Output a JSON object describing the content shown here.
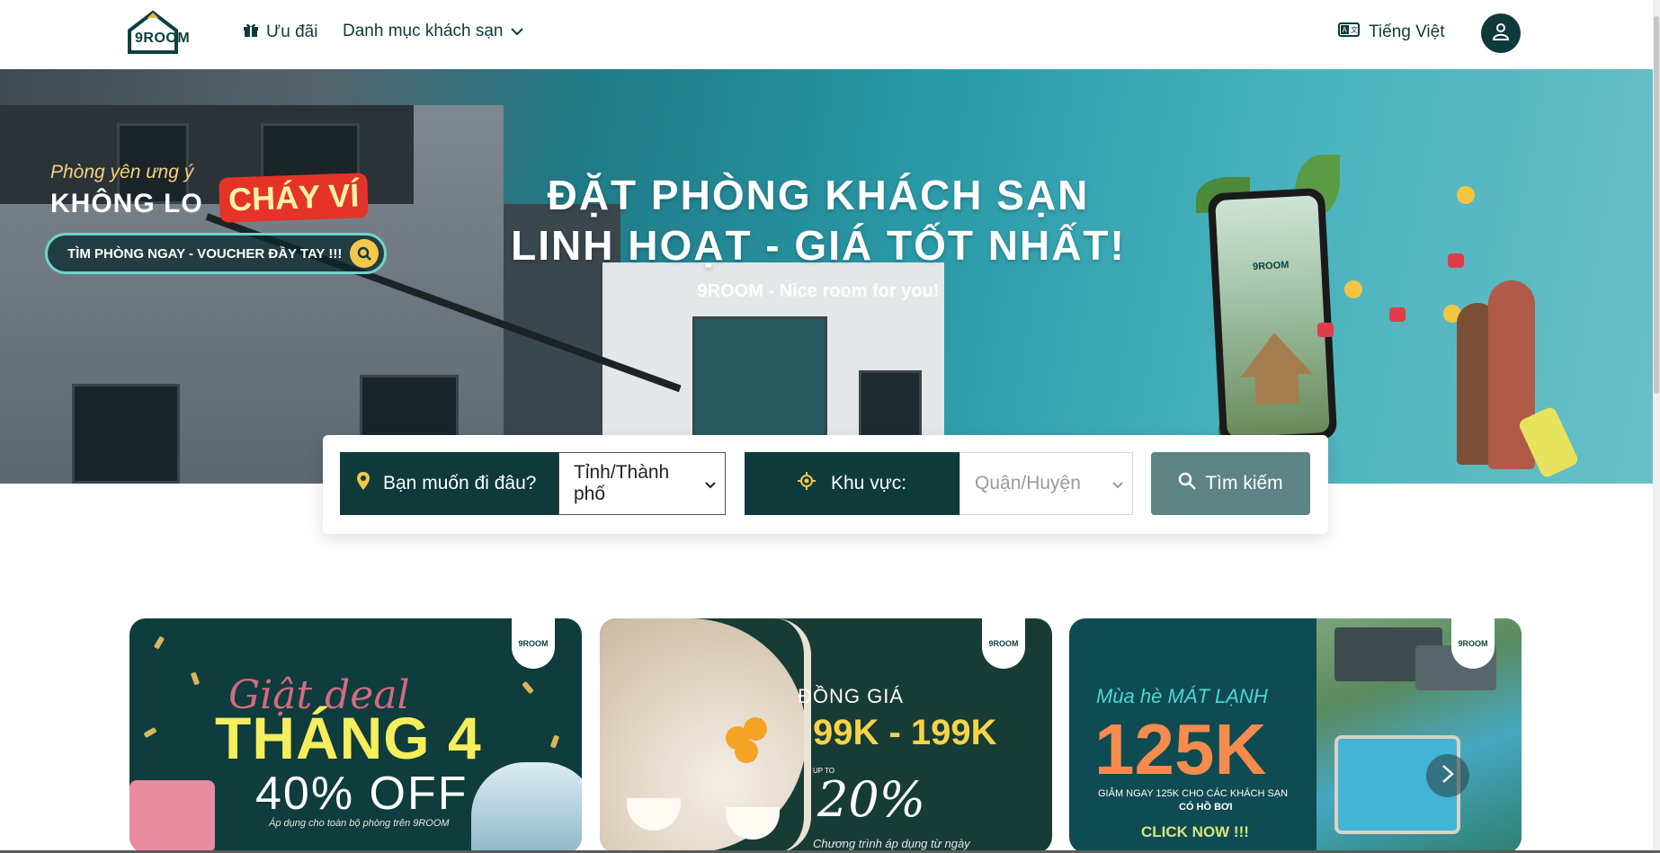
{
  "header": {
    "logo_text": "9ROOM",
    "nav": {
      "deals_label": "Ưu đãi",
      "category_label": "Danh mục khách sạn"
    },
    "language_label": "Tiếng Việt"
  },
  "hero": {
    "promo_line1": "Phòng yên ưng ý",
    "promo_line2": "KHÔNG LO",
    "promo_hot": "CHÁY VÍ",
    "promo_pill": "TÌM PHÒNG NGAY - VOUCHER ĐẦY TAY !!!",
    "title_line1": "ĐẶT PHÒNG KHÁCH SẠN",
    "title_line2": "LINH HOẠT - GIÁ TỐT NHẤT!",
    "subtitle": "9ROOM - Nice room for you!",
    "phone_logo": "9ROOM"
  },
  "search": {
    "where_label": "Bạn muốn đi đâu?",
    "city_select_value": "Tỉnh/Thành phố",
    "area_label": "Khu vực:",
    "district_select_value": "Quận/Huyện",
    "button_label": "Tìm kiếm"
  },
  "banners": [
    {
      "logo": "9ROOM",
      "script": "Giật deal",
      "headline": "THÁNG 4",
      "offer": "40% OFF",
      "note": "Áp dụng cho toàn bộ phòng trên 9ROOM"
    },
    {
      "logo": "9ROOM",
      "label": "ĐỒNG GIÁ",
      "price": "99K - 199K",
      "upto": "UP TO",
      "percent": "20%",
      "note": "Chương trình áp dụng từ ngày"
    },
    {
      "logo": "9ROOM",
      "label": "Mùa hè MÁT LẠNH",
      "headline": "125K",
      "small_line1": "GIẢM NGAY 125K CHO CÁC KHÁCH SẠN",
      "small_line2": "CÓ HỒ BƠI",
      "cta": "CLICK NOW !!!"
    }
  ],
  "colors": {
    "brand_dark": "#0e3a3c",
    "search_button": "#5e8384",
    "accent_yellow": "#f6ee5a",
    "accent_orange": "#f58b4c"
  },
  "icons": [
    "gift-icon",
    "chevron-down-icon",
    "language-icon",
    "user-icon",
    "map-pin-icon",
    "locate-icon",
    "search-icon",
    "chevron-right-icon"
  ]
}
